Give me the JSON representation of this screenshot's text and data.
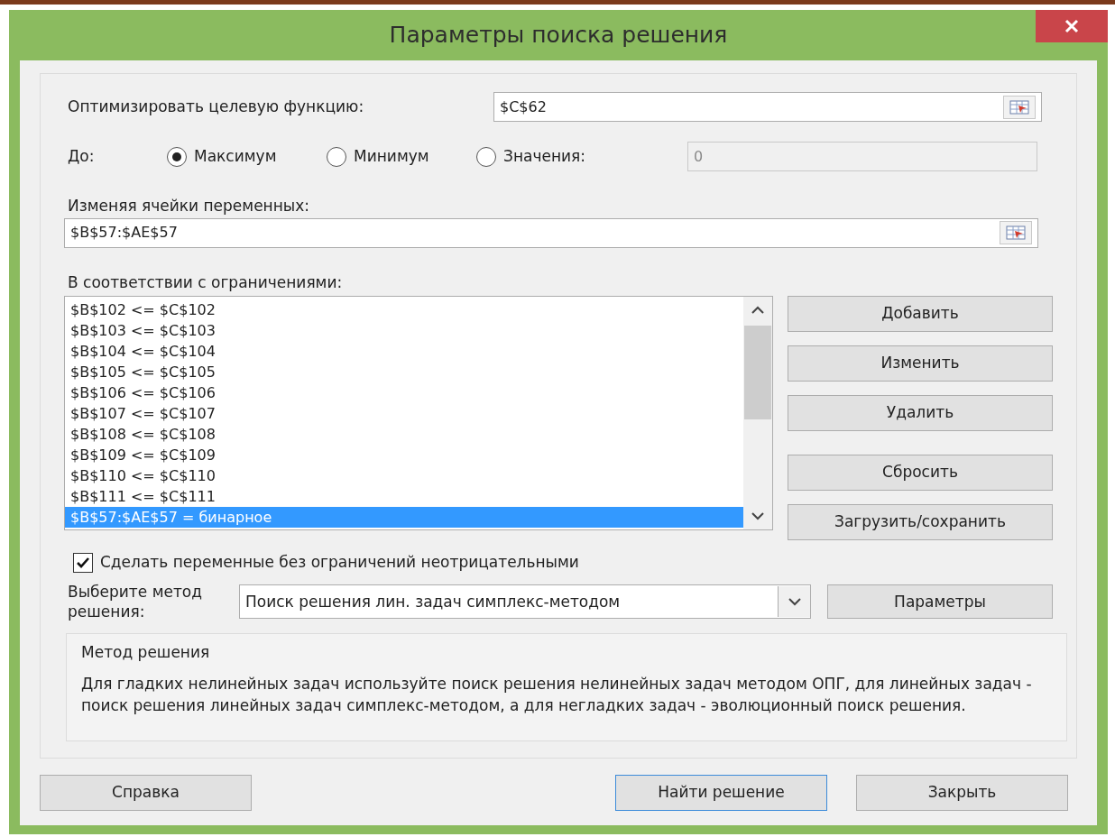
{
  "window": {
    "title": "Параметры поиска решения"
  },
  "objective": {
    "label": "Оптимизировать целевую функцию:",
    "value": "$C$62"
  },
  "to": {
    "label": "До:",
    "options": [
      {
        "label": "Максимум",
        "selected": true
      },
      {
        "label": "Минимум",
        "selected": false
      },
      {
        "label": "Значения:",
        "selected": false
      }
    ],
    "value_field": {
      "value": "0",
      "disabled": true
    }
  },
  "variables": {
    "label": "Изменяя ячейки переменных:",
    "value": "$B$57:$AE$57"
  },
  "constraints": {
    "label": "В соответствии с ограничениями:",
    "items": [
      {
        "text": "$B$102 <= $C$102",
        "selected": false
      },
      {
        "text": "$B$103 <= $C$103",
        "selected": false
      },
      {
        "text": "$B$104 <= $C$104",
        "selected": false
      },
      {
        "text": "$B$105 <= $C$105",
        "selected": false
      },
      {
        "text": "$B$106 <= $C$106",
        "selected": false
      },
      {
        "text": "$B$107 <= $C$107",
        "selected": false
      },
      {
        "text": "$B$108 <= $C$108",
        "selected": false
      },
      {
        "text": "$B$109 <= $C$109",
        "selected": false
      },
      {
        "text": "$B$110 <= $C$110",
        "selected": false
      },
      {
        "text": "$B$111 <= $C$111",
        "selected": false
      },
      {
        "text": "$B$57:$AE$57 = бинарное",
        "selected": true
      }
    ]
  },
  "constraint_buttons": [
    "Добавить",
    "Изменить",
    "Удалить",
    "Сбросить",
    "Загрузить/сохранить"
  ],
  "nonnegative": {
    "label": "Сделать переменные без ограничений неотрицательными",
    "checked": true
  },
  "method": {
    "label": "Выберите метод решения:",
    "value": "Поиск решения лин. задач симплекс-методом",
    "options_button": "Параметры"
  },
  "description": {
    "title": "Метод решения",
    "text": "Для гладких нелинейных задач используйте поиск решения нелинейных задач методом ОПГ, для линейных задач - поиск решения линейных задач симплекс-методом, а для негладких задач - эволюционный поиск решения."
  },
  "footer_buttons": [
    {
      "label": "Справка",
      "default": false
    },
    {
      "label": "Найти решение",
      "default": true
    },
    {
      "label": "Закрыть",
      "default": false
    }
  ]
}
